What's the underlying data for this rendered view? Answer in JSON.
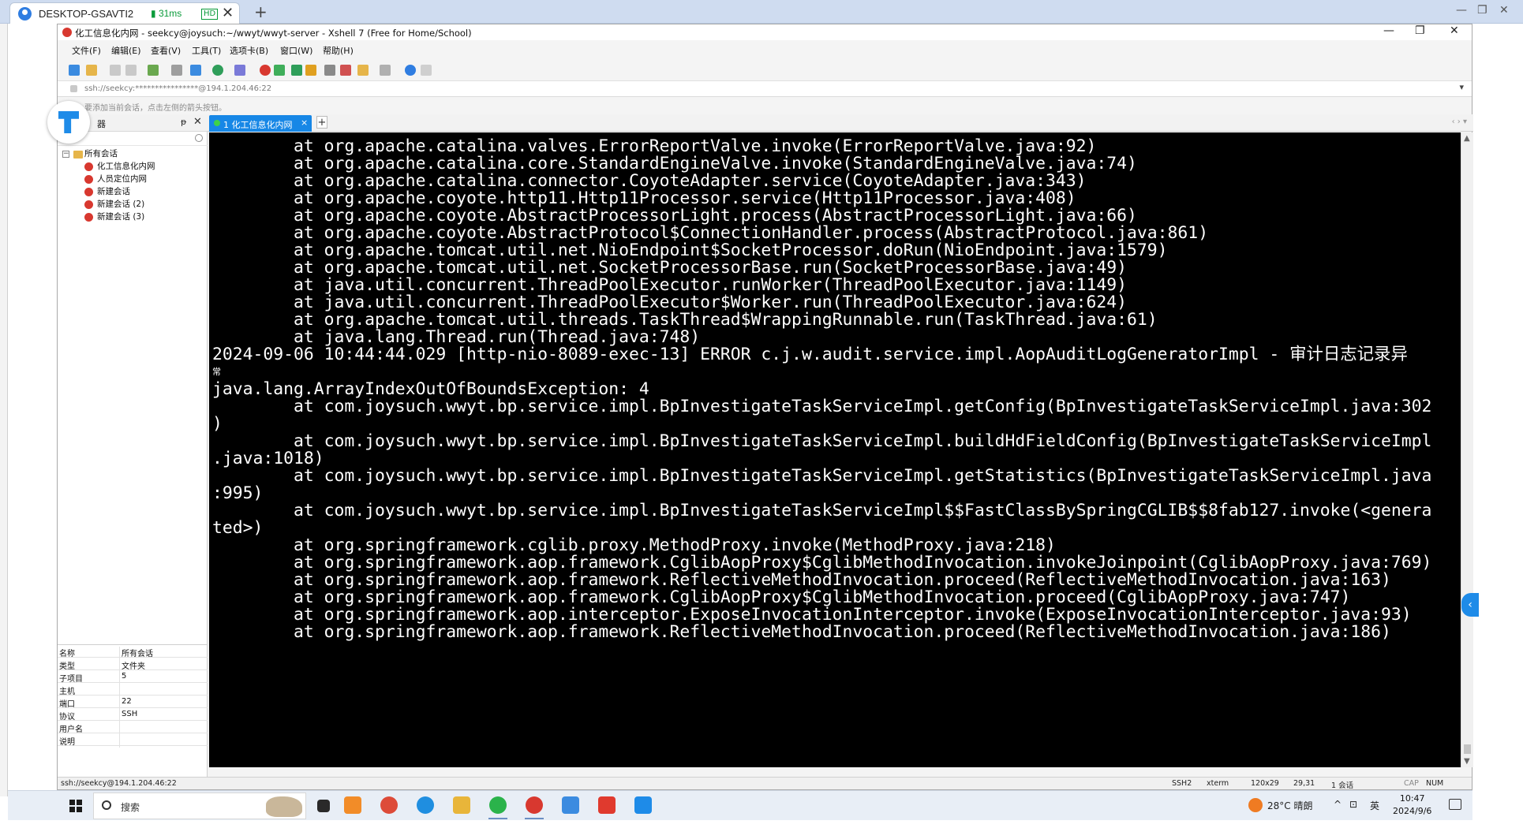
{
  "remote": {
    "title": "DESKTOP-GSAVTI2",
    "latency": "31ms",
    "quality": "HD",
    "close_glyph": "✕",
    "add_glyph": "+",
    "win_min": "—",
    "win_restore": "❐",
    "win_close": "✕"
  },
  "window": {
    "title": "化工信息化内网 - seekcy@joysuch:~/wwyt/wwyt-server - Xshell 7 (Free for Home/School)",
    "min": "—",
    "restore": "❐",
    "close": "✕"
  },
  "menu": [
    "文件(F)",
    "编辑(E)",
    "查看(V)",
    "工具(T)",
    "选项卡(B)",
    "窗口(W)",
    "帮助(H)"
  ],
  "address": "ssh://seekcy:****************@194.1.204.46:22",
  "hint": "要添加当前会话，点击左侧的箭头按钮。",
  "session_manager": {
    "title": "器",
    "pin": "ᵽ",
    "close": "✕",
    "root_toggle": "−",
    "root": "所有会话",
    "sessions": [
      "化工信息化内网",
      "人员定位内网",
      "新建会话",
      "新建会话 (2)",
      "新建会话 (3)"
    ],
    "properties": [
      {
        "key": "名称",
        "value": "所有会话"
      },
      {
        "key": "类型",
        "value": "文件夹"
      },
      {
        "key": "子项目",
        "value": "5"
      },
      {
        "key": "主机",
        "value": ""
      },
      {
        "key": "端口",
        "value": "22"
      },
      {
        "key": "协议",
        "value": "SSH"
      },
      {
        "key": "用户名",
        "value": ""
      },
      {
        "key": "说明",
        "value": ""
      }
    ]
  },
  "tab": {
    "label": "1 化工信息化内网",
    "close": "×",
    "add": "+",
    "nav": "‹ ›  ▾"
  },
  "terminal": {
    "lines": [
      "        at org.apache.catalina.valves.ErrorReportValve.invoke(ErrorReportValve.java:92)",
      "        at org.apache.catalina.core.StandardEngineValve.invoke(StandardEngineValve.java:74)",
      "        at org.apache.catalina.connector.CoyoteAdapter.service(CoyoteAdapter.java:343)",
      "        at org.apache.coyote.http11.Http11Processor.service(Http11Processor.java:408)",
      "        at org.apache.coyote.AbstractProcessorLight.process(AbstractProcessorLight.java:66)",
      "        at org.apache.coyote.AbstractProtocol$ConnectionHandler.process(AbstractProtocol.java:861)",
      "        at org.apache.tomcat.util.net.NioEndpoint$SocketProcessor.doRun(NioEndpoint.java:1579)",
      "        at org.apache.tomcat.util.net.SocketProcessorBase.run(SocketProcessorBase.java:49)",
      "        at java.util.concurrent.ThreadPoolExecutor.runWorker(ThreadPoolExecutor.java:1149)",
      "        at java.util.concurrent.ThreadPoolExecutor$Worker.run(ThreadPoolExecutor.java:624)",
      "        at org.apache.tomcat.util.threads.TaskThread$WrappingRunnable.run(TaskThread.java:61)",
      "        at java.lang.Thread.run(Thread.java:748)",
      "2024-09-06 10:44:44.029 [http-nio-8089-exec-13] ERROR c.j.w.audit.service.impl.AopAuditLogGeneratorImpl - 审计日志记录异",
      "常",
      "java.lang.ArrayIndexOutOfBoundsException: 4",
      "        at com.joysuch.wwyt.bp.service.impl.BpInvestigateTaskServiceImpl.getConfig(BpInvestigateTaskServiceImpl.java:302",
      ")",
      "        at com.joysuch.wwyt.bp.service.impl.BpInvestigateTaskServiceImpl.buildHdFieldConfig(BpInvestigateTaskServiceImpl",
      ".java:1018)",
      "        at com.joysuch.wwyt.bp.service.impl.BpInvestigateTaskServiceImpl.getStatistics(BpInvestigateTaskServiceImpl.java",
      ":995)",
      "        at com.joysuch.wwyt.bp.service.impl.BpInvestigateTaskServiceImpl$$FastClassBySpringCGLIB$$8fab127.invoke(<genera",
      "ted>)",
      "        at org.springframework.cglib.proxy.MethodProxy.invoke(MethodProxy.java:218)",
      "        at org.springframework.aop.framework.CglibAopProxy$CglibMethodInvocation.invokeJoinpoint(CglibAopProxy.java:769)",
      "        at org.springframework.aop.framework.ReflectiveMethodInvocation.proceed(ReflectiveMethodInvocation.java:163)",
      "        at org.springframework.aop.framework.CglibAopProxy$CglibMethodInvocation.proceed(CglibAopProxy.java:747)",
      "        at org.springframework.aop.interceptor.ExposeInvocationInterceptor.invoke(ExposeInvocationInterceptor.java:93)",
      "        at org.springframework.aop.framework.ReflectiveMethodInvocation.proceed(ReflectiveMethodInvocation.java:186)"
    ]
  },
  "status": {
    "address": "ssh://seekcy@194.1.204.46:22",
    "protocol": "SSH2",
    "term": "xterm",
    "size": "120x29",
    "cursor": "29,31",
    "sessions": "1 会话",
    "cap": "CAP",
    "num": "NUM"
  },
  "taskbar": {
    "search": "搜索",
    "weather": "28°C  晴朗",
    "ime": "英",
    "time": "10:47",
    "date": "2024/9/6"
  },
  "colors": {
    "terminal_bg": "#000000",
    "terminal_fg": "#ffffff",
    "tab_active": "#1787e6",
    "accent": "#1e8be8"
  }
}
